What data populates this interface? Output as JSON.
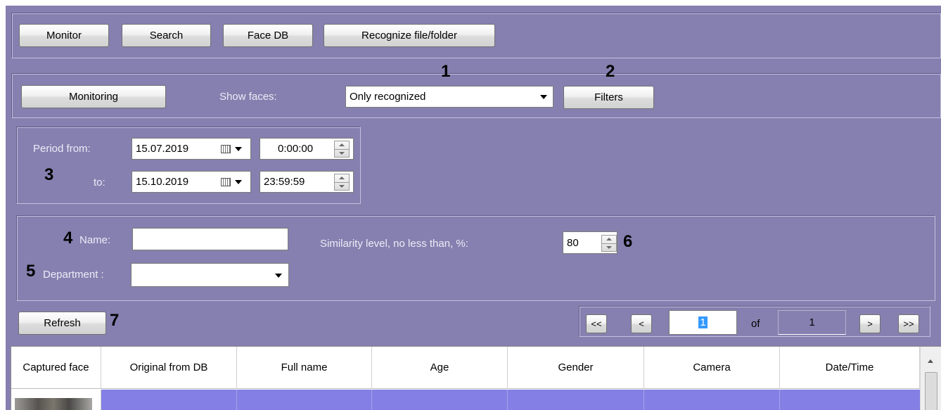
{
  "top_nav": {
    "monitor": "Monitor",
    "search": "Search",
    "face_db": "Face DB",
    "recognize": "Recognize file/folder"
  },
  "toolbar": {
    "monitoring": "Monitoring",
    "show_faces_label": "Show faces:",
    "show_faces_value": "Only recognized",
    "filters": "Filters"
  },
  "period": {
    "from_label": "Period from:",
    "to_label": "to:",
    "from_date": "15.07.2019",
    "from_time": "0:00:00",
    "to_date": "15.10.2019",
    "to_time": "23:59:59"
  },
  "filters": {
    "name_label": "Name:",
    "name_value": "",
    "department_label": "Department :",
    "department_value": "",
    "similarity_label": "Similarity level, no less than, %:",
    "similarity_value": "80"
  },
  "actions": {
    "refresh": "Refresh"
  },
  "pagination": {
    "first": "<<",
    "prev": "<",
    "page": "1",
    "of_label": "of",
    "total": "1",
    "next": ">",
    "last": ">>"
  },
  "callouts": [
    "1",
    "2",
    "3",
    "4",
    "5",
    "6",
    "7"
  ],
  "table": {
    "columns": [
      "Captured face",
      "Original from DB",
      "Full name",
      "Age",
      "Gender",
      "Camera",
      "Date/Time"
    ]
  },
  "colors": {
    "panel": "#8680b0",
    "selected_row": "#837fe4",
    "page_highlight": "#3399ff"
  }
}
